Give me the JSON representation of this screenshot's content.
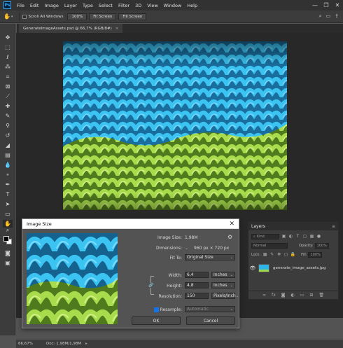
{
  "app": {
    "logo": "Ps",
    "menu": [
      "File",
      "Edit",
      "Image",
      "Layer",
      "Type",
      "Select",
      "Filter",
      "3D",
      "View",
      "Window",
      "Help"
    ],
    "window_controls": [
      "—",
      "❐",
      "✕"
    ]
  },
  "options": {
    "scroll_all_windows": "Scroll All Windows",
    "zoom_100": "100%",
    "fit_screen": "Fit Screen",
    "fill_screen": "Fill Screen"
  },
  "document": {
    "tab_title": "GenerateImageAssets.psd @ 66,7% (RGB/8#)",
    "tab_close": "×"
  },
  "status": {
    "zoom": "66,67%",
    "doc_size": "Doc: 1,98M/1,98M"
  },
  "layers": {
    "tab": "Layers",
    "search_placeholder": "Kind",
    "blend_mode": "Normal",
    "opacity_label": "Opacity:",
    "opacity_value": "100%",
    "fill_label": "Fill:",
    "fill_value": "100%",
    "lock_label": "Lock:",
    "layer_name": "generate_image_assets.jpg"
  },
  "dialog": {
    "title": "Image Size",
    "close": "✕",
    "image_size_label": "Image Size:",
    "image_size_value": "1,98M",
    "dimensions_label": "Dimensions:",
    "dimensions_value": "960 px × 720 px",
    "fit_to_label": "Fit To:",
    "fit_to_value": "Original Size",
    "width_label": "Width:",
    "width_value": "6,4",
    "width_unit": "Inches",
    "height_label": "Height:",
    "height_value": "4,8",
    "height_unit": "Inches",
    "resolution_label": "Resolution:",
    "resolution_value": "150",
    "resolution_unit": "Pixels/Inch",
    "resample_label": "Resample:",
    "resample_value": "Automatic",
    "ok": "OK",
    "cancel": "Cancel"
  },
  "colors": {
    "blue_yarn": "#2fb4e8",
    "green_yarn": "#9fd64a",
    "ps_blue": "#31a8ff"
  }
}
